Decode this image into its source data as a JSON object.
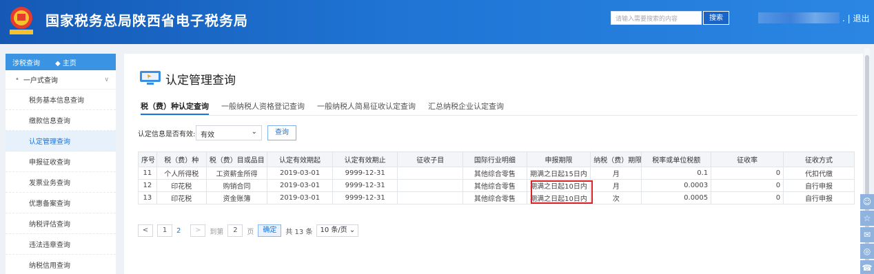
{
  "header": {
    "title": "国家税务总局陕西省电子税务局",
    "search_placeholder": "请输入需要搜索的内容",
    "search_button": "搜索",
    "logout": ". | 退出"
  },
  "sidebar": {
    "head_label": "涉税查询",
    "home_label": "◆ 主页",
    "group_label": "一户式查询",
    "items": [
      {
        "label": "税务基本信息查询"
      },
      {
        "label": "缴款信息查询"
      },
      {
        "label": "认定管理查询"
      },
      {
        "label": "申报征收查询"
      },
      {
        "label": "发票业务查询"
      },
      {
        "label": "优惠备案查询"
      },
      {
        "label": "纳税评估查询"
      },
      {
        "label": "违法违章查询"
      },
      {
        "label": "纳税信用查询"
      }
    ]
  },
  "main": {
    "title": "认定管理查询",
    "tabs": [
      {
        "label": "税（费）种认定查询"
      },
      {
        "label": "一般纳税人资格登记查询"
      },
      {
        "label": "一般纳税人简易征收认定查询"
      },
      {
        "label": "汇总纳税企业认定查询"
      }
    ],
    "filter": {
      "label": "认定信息是否有效:",
      "value": "有效",
      "query_button": "查询"
    },
    "table": {
      "headers": [
        "序号",
        "税（费）种",
        "税（费）目或品目",
        "认定有效期起",
        "认定有效期止",
        "征收子目",
        "国际行业明细",
        "申报期限",
        "纳税（费）期限",
        "税率或单位税额",
        "征收率",
        "征收方式"
      ],
      "rows": [
        [
          "11",
          "个人所得税",
          "工资薪金所得",
          "2019-03-01",
          "9999-12-31",
          "",
          "其他综合零售",
          "期满之日起15日内",
          "月",
          "0.1",
          "0",
          "代扣代缴"
        ],
        [
          "12",
          "印花税",
          "购销合同",
          "2019-03-01",
          "9999-12-31",
          "",
          "其他综合零售",
          "期满之日起10日内",
          "月",
          "0.0003",
          "0",
          "自行申报"
        ],
        [
          "13",
          "印花税",
          "资金账簿",
          "2019-03-01",
          "9999-12-31",
          "",
          "其他综合零售",
          "期满之日起10日内",
          "次",
          "0.0005",
          "0",
          "自行申报"
        ]
      ]
    },
    "pager": {
      "prev": "<",
      "page1": "1",
      "page2": "2",
      "next": ">",
      "goto_label": "到第",
      "goto_value": "2",
      "page_label": "页",
      "confirm": "确定",
      "total": "共 13 条",
      "page_size": "10 条/页 ⌄"
    }
  },
  "icons": {
    "menu_chevron": "chevron-down-icon",
    "page_icon": "monitor-icon",
    "float": [
      "user-icon",
      "star-icon",
      "chat-icon",
      "weibo-icon",
      "phone-icon"
    ]
  }
}
